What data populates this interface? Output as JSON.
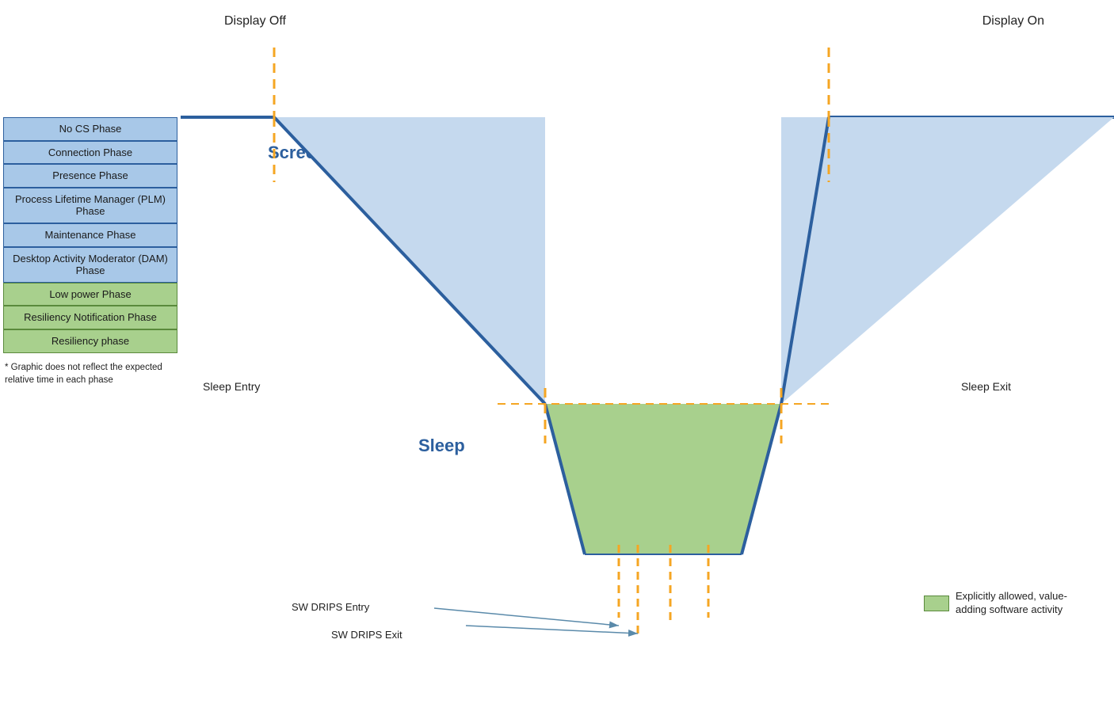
{
  "labels": {
    "display_off": "Display Off",
    "display_on": "Display On",
    "screen_off": "Screen Off",
    "sleep": "Sleep",
    "sleep_entry": "Sleep Entry",
    "sleep_exit": "Sleep Exit",
    "sw_drips_entry": "SW DRIPS Entry",
    "sw_drips_exit": "SW DRIPS Exit",
    "legend_text": "Explicitly allowed, value-adding software activity",
    "footnote": "* Graphic does not reflect the expected relative time in each phase"
  },
  "phases": [
    {
      "label": "No CS Phase",
      "green": false
    },
    {
      "label": "Connection Phase",
      "green": false
    },
    {
      "label": "Presence Phase",
      "green": false
    },
    {
      "label": "Process Lifetime Manager (PLM) Phase",
      "green": false
    },
    {
      "label": "Maintenance Phase",
      "green": false
    },
    {
      "label": "Desktop Activity Moderator (DAM) Phase",
      "green": false
    },
    {
      "label": "Low power Phase",
      "green": true
    },
    {
      "label": "Resiliency Notification Phase",
      "green": true
    },
    {
      "label": "Resiliency phase",
      "green": true
    }
  ],
  "colors": {
    "blue_fill": "#c5d9ee",
    "blue_stroke": "#2c5f9e",
    "green_fill": "#a8d08d",
    "green_stroke": "#5a8a3c",
    "yellow_dash": "#f5a623",
    "horizontal_line": "#2c5f9e"
  }
}
